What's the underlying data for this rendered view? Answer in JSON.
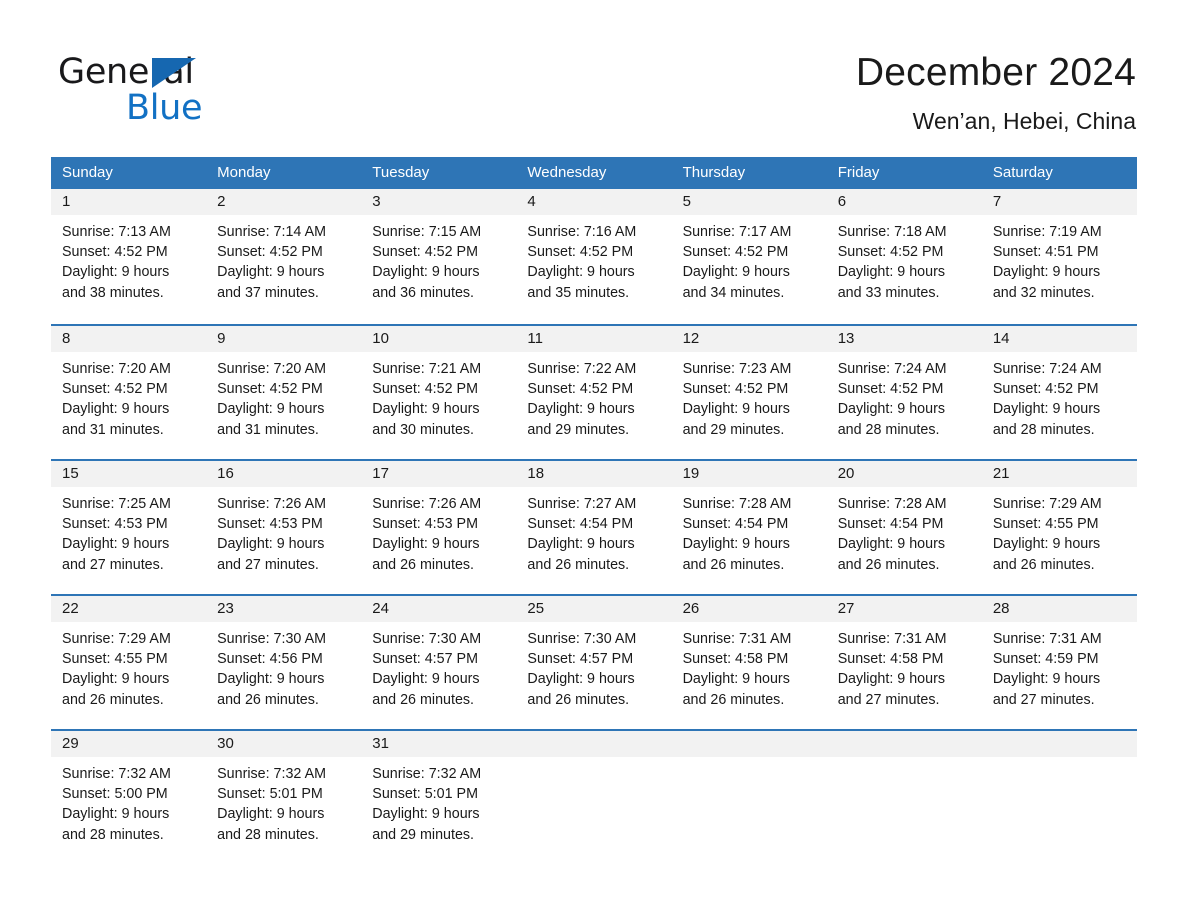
{
  "brand": {
    "name_part1": "General",
    "name_part2": "Blue",
    "flag_color": "#1667b0",
    "blue_color": "#1271c4"
  },
  "header": {
    "title": "December 2024",
    "location": "Wen’an, Hebei, China"
  },
  "theme": {
    "header_row_bg": "#2e75b6",
    "daynum_band_bg": "#f2f2f2",
    "week_divider": "#2e75b6",
    "text": "#1a1a1a"
  },
  "weekdays": [
    "Sunday",
    "Monday",
    "Tuesday",
    "Wednesday",
    "Thursday",
    "Friday",
    "Saturday"
  ],
  "weeks": [
    [
      {
        "day": "1",
        "sunrise": "Sunrise: 7:13 AM",
        "sunset": "Sunset: 4:52 PM",
        "daylight1": "Daylight: 9 hours",
        "daylight2": "and 38 minutes."
      },
      {
        "day": "2",
        "sunrise": "Sunrise: 7:14 AM",
        "sunset": "Sunset: 4:52 PM",
        "daylight1": "Daylight: 9 hours",
        "daylight2": "and 37 minutes."
      },
      {
        "day": "3",
        "sunrise": "Sunrise: 7:15 AM",
        "sunset": "Sunset: 4:52 PM",
        "daylight1": "Daylight: 9 hours",
        "daylight2": "and 36 minutes."
      },
      {
        "day": "4",
        "sunrise": "Sunrise: 7:16 AM",
        "sunset": "Sunset: 4:52 PM",
        "daylight1": "Daylight: 9 hours",
        "daylight2": "and 35 minutes."
      },
      {
        "day": "5",
        "sunrise": "Sunrise: 7:17 AM",
        "sunset": "Sunset: 4:52 PM",
        "daylight1": "Daylight: 9 hours",
        "daylight2": "and 34 minutes."
      },
      {
        "day": "6",
        "sunrise": "Sunrise: 7:18 AM",
        "sunset": "Sunset: 4:52 PM",
        "daylight1": "Daylight: 9 hours",
        "daylight2": "and 33 minutes."
      },
      {
        "day": "7",
        "sunrise": "Sunrise: 7:19 AM",
        "sunset": "Sunset: 4:51 PM",
        "daylight1": "Daylight: 9 hours",
        "daylight2": "and 32 minutes."
      }
    ],
    [
      {
        "day": "8",
        "sunrise": "Sunrise: 7:20 AM",
        "sunset": "Sunset: 4:52 PM",
        "daylight1": "Daylight: 9 hours",
        "daylight2": "and 31 minutes."
      },
      {
        "day": "9",
        "sunrise": "Sunrise: 7:20 AM",
        "sunset": "Sunset: 4:52 PM",
        "daylight1": "Daylight: 9 hours",
        "daylight2": "and 31 minutes."
      },
      {
        "day": "10",
        "sunrise": "Sunrise: 7:21 AM",
        "sunset": "Sunset: 4:52 PM",
        "daylight1": "Daylight: 9 hours",
        "daylight2": "and 30 minutes."
      },
      {
        "day": "11",
        "sunrise": "Sunrise: 7:22 AM",
        "sunset": "Sunset: 4:52 PM",
        "daylight1": "Daylight: 9 hours",
        "daylight2": "and 29 minutes."
      },
      {
        "day": "12",
        "sunrise": "Sunrise: 7:23 AM",
        "sunset": "Sunset: 4:52 PM",
        "daylight1": "Daylight: 9 hours",
        "daylight2": "and 29 minutes."
      },
      {
        "day": "13",
        "sunrise": "Sunrise: 7:24 AM",
        "sunset": "Sunset: 4:52 PM",
        "daylight1": "Daylight: 9 hours",
        "daylight2": "and 28 minutes."
      },
      {
        "day": "14",
        "sunrise": "Sunrise: 7:24 AM",
        "sunset": "Sunset: 4:52 PM",
        "daylight1": "Daylight: 9 hours",
        "daylight2": "and 28 minutes."
      }
    ],
    [
      {
        "day": "15",
        "sunrise": "Sunrise: 7:25 AM",
        "sunset": "Sunset: 4:53 PM",
        "daylight1": "Daylight: 9 hours",
        "daylight2": "and 27 minutes."
      },
      {
        "day": "16",
        "sunrise": "Sunrise: 7:26 AM",
        "sunset": "Sunset: 4:53 PM",
        "daylight1": "Daylight: 9 hours",
        "daylight2": "and 27 minutes."
      },
      {
        "day": "17",
        "sunrise": "Sunrise: 7:26 AM",
        "sunset": "Sunset: 4:53 PM",
        "daylight1": "Daylight: 9 hours",
        "daylight2": "and 26 minutes."
      },
      {
        "day": "18",
        "sunrise": "Sunrise: 7:27 AM",
        "sunset": "Sunset: 4:54 PM",
        "daylight1": "Daylight: 9 hours",
        "daylight2": "and 26 minutes."
      },
      {
        "day": "19",
        "sunrise": "Sunrise: 7:28 AM",
        "sunset": "Sunset: 4:54 PM",
        "daylight1": "Daylight: 9 hours",
        "daylight2": "and 26 minutes."
      },
      {
        "day": "20",
        "sunrise": "Sunrise: 7:28 AM",
        "sunset": "Sunset: 4:54 PM",
        "daylight1": "Daylight: 9 hours",
        "daylight2": "and 26 minutes."
      },
      {
        "day": "21",
        "sunrise": "Sunrise: 7:29 AM",
        "sunset": "Sunset: 4:55 PM",
        "daylight1": "Daylight: 9 hours",
        "daylight2": "and 26 minutes."
      }
    ],
    [
      {
        "day": "22",
        "sunrise": "Sunrise: 7:29 AM",
        "sunset": "Sunset: 4:55 PM",
        "daylight1": "Daylight: 9 hours",
        "daylight2": "and 26 minutes."
      },
      {
        "day": "23",
        "sunrise": "Sunrise: 7:30 AM",
        "sunset": "Sunset: 4:56 PM",
        "daylight1": "Daylight: 9 hours",
        "daylight2": "and 26 minutes."
      },
      {
        "day": "24",
        "sunrise": "Sunrise: 7:30 AM",
        "sunset": "Sunset: 4:57 PM",
        "daylight1": "Daylight: 9 hours",
        "daylight2": "and 26 minutes."
      },
      {
        "day": "25",
        "sunrise": "Sunrise: 7:30 AM",
        "sunset": "Sunset: 4:57 PM",
        "daylight1": "Daylight: 9 hours",
        "daylight2": "and 26 minutes."
      },
      {
        "day": "26",
        "sunrise": "Sunrise: 7:31 AM",
        "sunset": "Sunset: 4:58 PM",
        "daylight1": "Daylight: 9 hours",
        "daylight2": "and 26 minutes."
      },
      {
        "day": "27",
        "sunrise": "Sunrise: 7:31 AM",
        "sunset": "Sunset: 4:58 PM",
        "daylight1": "Daylight: 9 hours",
        "daylight2": "and 27 minutes."
      },
      {
        "day": "28",
        "sunrise": "Sunrise: 7:31 AM",
        "sunset": "Sunset: 4:59 PM",
        "daylight1": "Daylight: 9 hours",
        "daylight2": "and 27 minutes."
      }
    ],
    [
      {
        "day": "29",
        "sunrise": "Sunrise: 7:32 AM",
        "sunset": "Sunset: 5:00 PM",
        "daylight1": "Daylight: 9 hours",
        "daylight2": "and 28 minutes."
      },
      {
        "day": "30",
        "sunrise": "Sunrise: 7:32 AM",
        "sunset": "Sunset: 5:01 PM",
        "daylight1": "Daylight: 9 hours",
        "daylight2": "and 28 minutes."
      },
      {
        "day": "31",
        "sunrise": "Sunrise: 7:32 AM",
        "sunset": "Sunset: 5:01 PM",
        "daylight1": "Daylight: 9 hours",
        "daylight2": "and 29 minutes."
      },
      {
        "day": "",
        "sunrise": "",
        "sunset": "",
        "daylight1": "",
        "daylight2": ""
      },
      {
        "day": "",
        "sunrise": "",
        "sunset": "",
        "daylight1": "",
        "daylight2": ""
      },
      {
        "day": "",
        "sunrise": "",
        "sunset": "",
        "daylight1": "",
        "daylight2": ""
      },
      {
        "day": "",
        "sunrise": "",
        "sunset": "",
        "daylight1": "",
        "daylight2": ""
      }
    ]
  ]
}
